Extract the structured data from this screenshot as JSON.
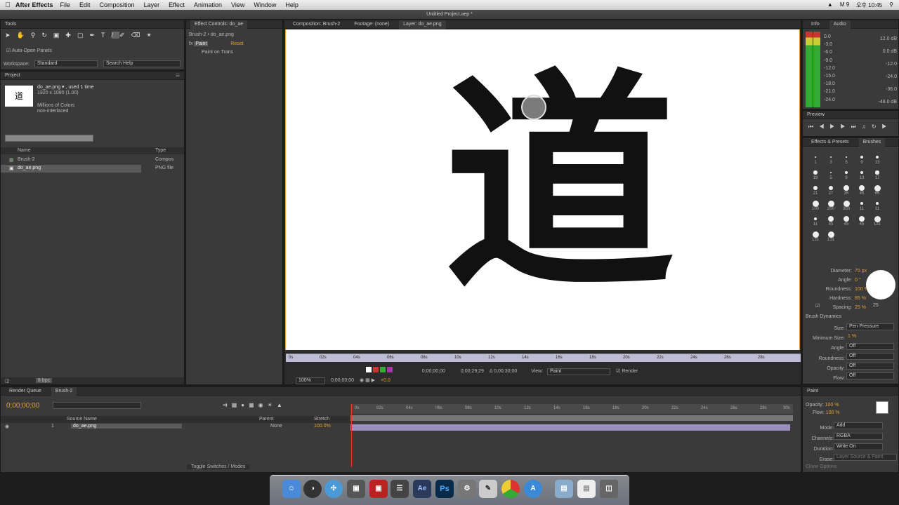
{
  "menubar": {
    "app": "After Effects",
    "items": [
      "File",
      "Edit",
      "Composition",
      "Layer",
      "Effect",
      "Animation",
      "View",
      "Window",
      "Help"
    ],
    "status": [
      "M 9",
      "오후 10:45"
    ]
  },
  "window": {
    "title": "Untitled Project.aep *"
  },
  "tools": {
    "title": "Tools",
    "auto_open": "Auto-Open Panels",
    "workspace_label": "Workspace:",
    "workspace_value": "Standard",
    "search_placeholder": "Search Help"
  },
  "project": {
    "title": "Project",
    "file_name": "do_ae.png ▾ , used 1 time",
    "file_size": "1920 x 1080 (1.00)",
    "colors": "Millions of Colors",
    "interlace": "non-interlaced",
    "col_name": "Name",
    "col_type": "Type",
    "items": [
      {
        "name": "Brush-2",
        "type": "Compos"
      },
      {
        "name": "do_ae.png",
        "type": "PNG file"
      }
    ],
    "bpc": "8 bpc"
  },
  "effect_controls": {
    "title": "Effect Controls: do_ae",
    "subtitle": "Brush-2 • do_ae.png",
    "effect": "Paint",
    "reset": "Reset",
    "paint_on": "Paint on Trans"
  },
  "viewer": {
    "tabs": [
      "Composition: Brush-2",
      "Footage: (none)",
      "Layer: do_ae.png"
    ],
    "character": "道",
    "ruler_ticks": [
      "0s",
      "02s",
      "04s",
      "06s",
      "08s",
      "10s",
      "12s",
      "14s",
      "16s",
      "18s",
      "20s",
      "22s",
      "24s",
      "26s",
      "28s"
    ],
    "time_in": "0;00;00;00",
    "time_out": "0;00;29;29",
    "duration": "Δ 0;00;30;00",
    "view_label": "View:",
    "view_value": "Paint",
    "render": "Render",
    "zoom": "100%",
    "current_time": "0;00;00;00",
    "exposure": "+0.0"
  },
  "info": {
    "tabs": [
      "Info",
      "Audio"
    ],
    "db_left": [
      "0.0",
      "-3.0",
      "-6.0",
      "-9.0",
      "-12.0",
      "-15.0",
      "-18.0",
      "-21.0",
      "-24.0"
    ],
    "db_right": [
      "12.0 dB",
      "0.0 dB",
      "-12.0",
      "-24.0",
      "-36.0",
      "-48.0 dB"
    ]
  },
  "preview": {
    "title": "Preview"
  },
  "brushes": {
    "tabs": [
      "Effects & Presets",
      "Brushes"
    ],
    "sizes": [
      "1",
      "3",
      "5",
      "9",
      "13",
      "19",
      "5",
      "9",
      "13",
      "17",
      "21",
      "27",
      "35",
      "45",
      "65",
      "100",
      "200",
      "300",
      "11",
      "11",
      "11",
      "45",
      "45",
      "45",
      "131",
      "131",
      "131"
    ],
    "diameter_label": "Diameter:",
    "diameter": "75 px",
    "angle_label": "Angle:",
    "angle": "0 °",
    "roundness_label": "Roundness:",
    "roundness": "100 %",
    "hardness_label": "Hardness:",
    "hardness": "85 %",
    "spacing_label": "Spacing:",
    "spacing": "25 %",
    "spacing_preview": "25",
    "dynamics": "Brush Dynamics",
    "size_label": "Size:",
    "size": "Pen Pressure",
    "min_size_label": "Minimum Size:",
    "min_size": "1 %",
    "angle2_label": "Angle:",
    "angle2": "Off",
    "roundness2_label": "Roundness:",
    "roundness2": "Off",
    "opacity_label": "Opacity:",
    "opacity": "Off",
    "flow_label": "Flow:",
    "flow": "Off"
  },
  "paint": {
    "title": "Paint",
    "opacity_label": "Opacity:",
    "opacity": "100 %",
    "flow_label": "Flow:",
    "flow": "100 %",
    "mode_label": "Mode:",
    "mode": "Add",
    "channels_label": "Channels:",
    "channels": "RGBA",
    "duration_label": "Duration:",
    "duration": "Write On",
    "erase_label": "Erase:",
    "erase": "Layer Source & Paint",
    "clone": "Clone Options"
  },
  "timeline": {
    "tabs": [
      "Render Queue",
      "Brush-2"
    ],
    "timecode": "0;00;00;00",
    "col_source": "Source Name",
    "col_parent": "Parent",
    "col_stretch": "Stretch",
    "layer_num": "1",
    "layer_name": "do_ae.png",
    "parent": "None",
    "stretch": "100.0%",
    "toggle": "Toggle Switches / Modes",
    "ticks": [
      "0s",
      "02s",
      "04s",
      "06s",
      "08s",
      "10s",
      "12s",
      "14s",
      "16s",
      "18s",
      "20s",
      "22s",
      "24s",
      "26s",
      "28s",
      "30s"
    ]
  },
  "dock": [
    "Finder",
    "Dashboard",
    "Safari",
    "Photos",
    "Photo Booth",
    "Clapper",
    "Ae",
    "Ps",
    "Settings",
    "Preview",
    "Chrome",
    "App Store",
    "Folder",
    "Documents",
    "Trash"
  ]
}
